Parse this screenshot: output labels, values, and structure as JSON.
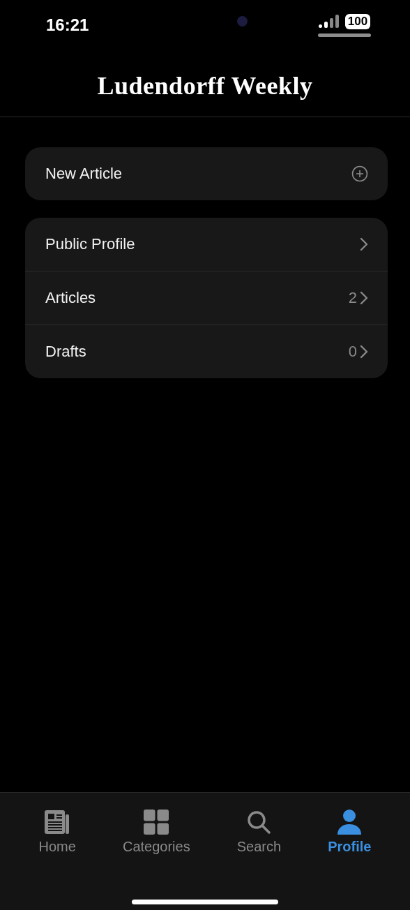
{
  "status_bar": {
    "time": "16:21",
    "battery": "100"
  },
  "header": {
    "title": "Ludendorff Weekly"
  },
  "groups": [
    {
      "rows": [
        {
          "label": "New Article",
          "kind": "add"
        }
      ]
    },
    {
      "rows": [
        {
          "label": "Public Profile",
          "kind": "link"
        },
        {
          "label": "Articles",
          "kind": "link",
          "count": "2"
        },
        {
          "label": "Drafts",
          "kind": "link",
          "count": "0"
        }
      ]
    }
  ],
  "tab_bar": [
    {
      "label": "Home",
      "kind": "news",
      "selected": false
    },
    {
      "label": "Categories",
      "kind": "grid",
      "selected": false
    },
    {
      "label": "Search",
      "kind": "search",
      "selected": false
    },
    {
      "label": "Profile",
      "kind": "person",
      "selected": true
    }
  ]
}
